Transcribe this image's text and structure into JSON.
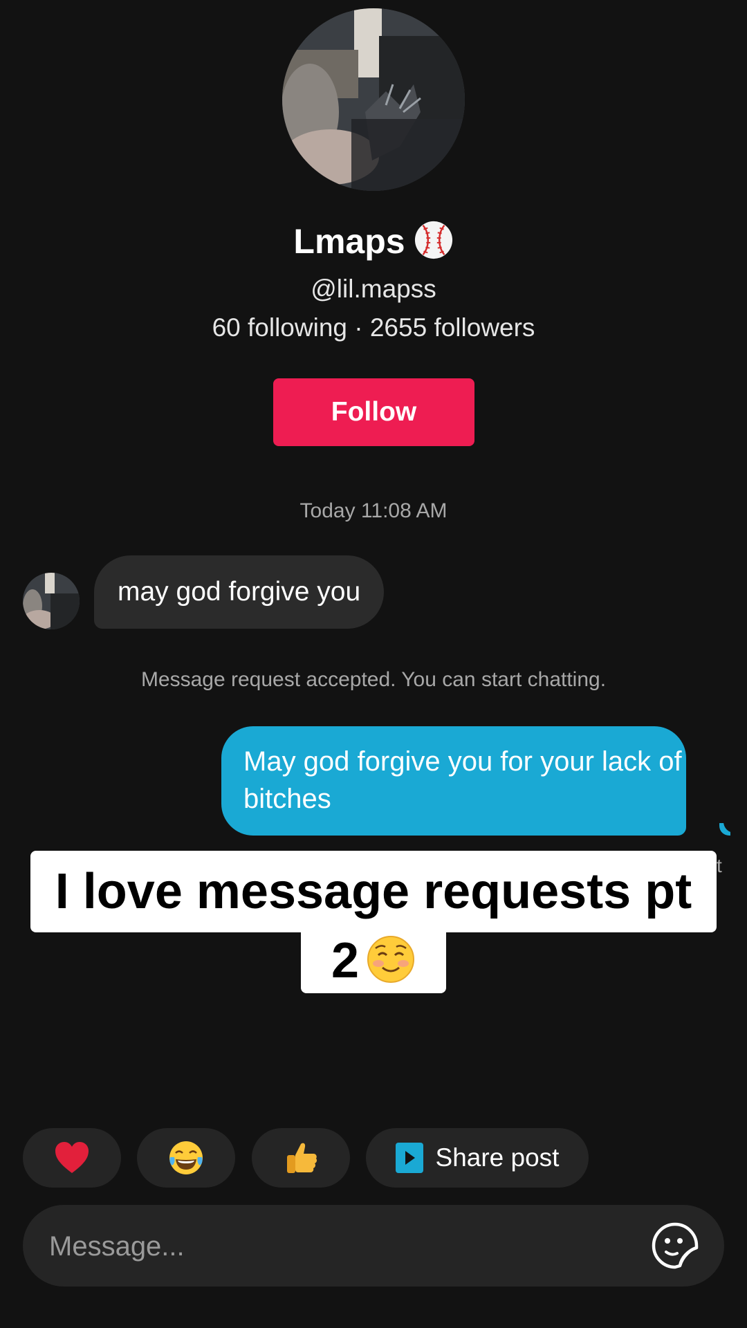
{
  "profile": {
    "name": "Lmaps",
    "name_emoji_icon": "baseball-icon",
    "handle": "@lil.mapss",
    "stats": "60 following · 2655 followers",
    "follow_label": "Follow"
  },
  "chat": {
    "timestamp": "Today 11:08 AM",
    "received_message": "may god forgive you",
    "system_note": "Message request accepted. You can start chatting.",
    "sent_message": "May god forgive you for your lack of bitches",
    "sent_status_partial": "t"
  },
  "overlay_caption": {
    "line1": "I love message requests pt",
    "line2": "2",
    "line2_emoji_icon": "smiling-face-icon"
  },
  "quick_reactions": [
    {
      "icon": "heart-icon"
    },
    {
      "icon": "tears-of-joy-icon"
    },
    {
      "icon": "thumbs-up-icon"
    },
    {
      "icon": "share-post-icon",
      "label": "Share post"
    }
  ],
  "composer": {
    "placeholder": "Message...",
    "sticker_icon": "sticker-icon"
  },
  "colors": {
    "background": "#121212",
    "follow_button": "#ee1d52",
    "sent_bubble": "#1aa9d4",
    "received_bubble": "#2b2b2b",
    "secondary_text": "#a8a8a8",
    "share_icon": "#1aa9d4"
  }
}
